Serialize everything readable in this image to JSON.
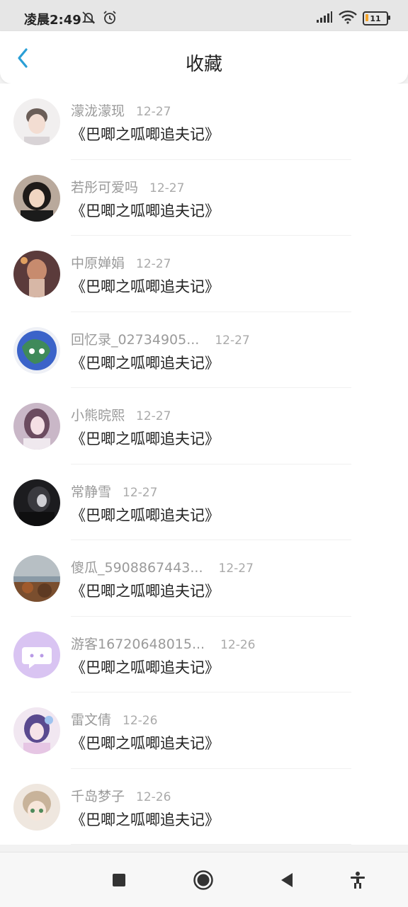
{
  "status_bar": {
    "time": "凌晨2:49",
    "battery": "11"
  },
  "header": {
    "title": "收藏"
  },
  "items": [
    {
      "name": "濛泷濛现",
      "date": "12-27",
      "title": "《巴唧之呱唧追夫记》"
    },
    {
      "name": "若彤可爱吗",
      "date": "12-27",
      "title": "《巴唧之呱唧追夫记》"
    },
    {
      "name": "中原婵娟",
      "date": "12-27",
      "title": "《巴唧之呱唧追夫记》"
    },
    {
      "name": "回忆录_02734905...",
      "date": "12-27",
      "title": "《巴唧之呱唧追夫记》"
    },
    {
      "name": "小熊晥熙",
      "date": "12-27",
      "title": "《巴唧之呱唧追夫记》"
    },
    {
      "name": "常静雪",
      "date": "12-27",
      "title": "《巴唧之呱唧追夫记》"
    },
    {
      "name": "傻瓜_5908867443...",
      "date": "12-27",
      "title": "《巴唧之呱唧追夫记》"
    },
    {
      "name": "游客16720648015...",
      "date": "12-26",
      "title": "《巴唧之呱唧追夫记》"
    },
    {
      "name": "雷文倩",
      "date": "12-26",
      "title": "《巴唧之呱唧追夫记》"
    },
    {
      "name": "千岛梦子",
      "date": "12-26",
      "title": "《巴唧之呱唧追夫记》"
    }
  ],
  "colors": {
    "accent": "#2a9fd6",
    "header_bg": "#ffffff",
    "status_bg": "#e6e6e6"
  },
  "icons": {
    "back": "chevron-left-icon",
    "nav_recents": "square-icon",
    "nav_home": "circle-icon",
    "nav_back": "triangle-left-icon",
    "nav_accessibility": "accessibility-icon"
  }
}
